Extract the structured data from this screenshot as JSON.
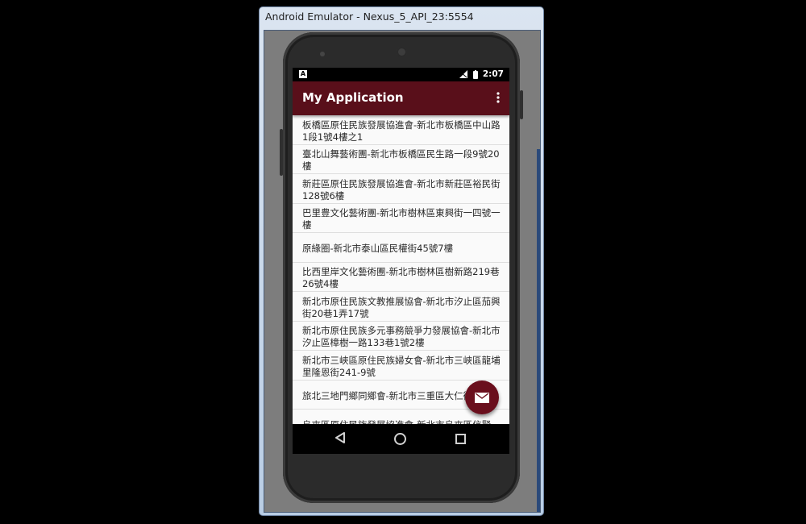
{
  "window": {
    "title": "Android Emulator - Nexus_5_API_23:5554"
  },
  "statusbar": {
    "notification_letter": "A",
    "time": "2:07"
  },
  "appbar": {
    "title": "My Application",
    "overflow_icon": "more-vert-icon"
  },
  "list": {
    "items": [
      "板橋區原住民族發展協進會-新北市板橋區中山路1段1號4樓之1",
      "臺北山舞藝術團-新北市板橋區民生路一段9號20樓",
      "新莊區原住民族發展協進會-新北市新莊區裕民街128號6樓",
      "巴里豊文化藝術團-新北市樹林區東興街一四號一樓",
      "原緣圈-新北市泰山區民權街45號7樓",
      "比西里岸文化藝術團-新北市樹林區樹新路219巷26號4樓",
      "新北市原住民族文教推展協會-新北市汐止區茄興街20巷1弄17號",
      "新北市原住民族多元事務競爭力發展協會-新北市汐止區樟樹一路133巷1號2樓",
      "新北市三峽區原住民族婦女會-新北市三峽區龍埔里隆恩街241-9號",
      "旅北三地門鄉同鄉會-新北市三重區大仁街 4F",
      "烏來區原住民族發展協進會-新北市烏來區信賢"
    ]
  },
  "fab": {
    "icon": "email-icon",
    "color": "#6a0f1d"
  },
  "navbar": {
    "back_icon": "back-triangle-icon",
    "home_icon": "home-circle-icon",
    "recents_icon": "recents-square-icon"
  },
  "colors": {
    "appbar": "#590f1a",
    "background": "#fafafa"
  }
}
